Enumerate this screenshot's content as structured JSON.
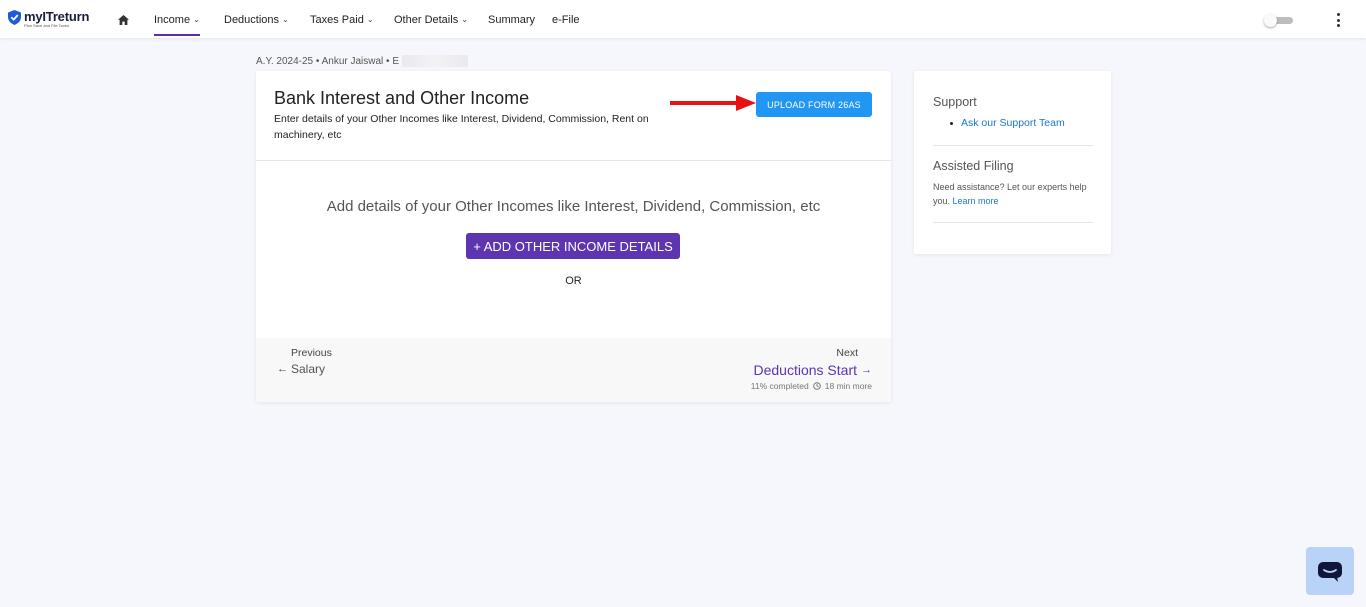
{
  "app": {
    "logo_name": "myITreturn",
    "logo_tagline": "Plan Save and File Taxes"
  },
  "nav": {
    "items": [
      {
        "label": "Income",
        "has_dropdown": true,
        "active": true
      },
      {
        "label": "Deductions",
        "has_dropdown": true
      },
      {
        "label": "Taxes Paid",
        "has_dropdown": true
      },
      {
        "label": "Other Details",
        "has_dropdown": true
      },
      {
        "label": "Summary",
        "has_dropdown": false
      },
      {
        "label": "e-File",
        "has_dropdown": false
      }
    ],
    "chevron": "⌄"
  },
  "breadcrumb": {
    "text": "A.Y. 2024-25 • Ankur Jaiswal • E"
  },
  "card": {
    "title": "Bank Interest and Other Income",
    "description": "Enter details of your Other Incomes like Interest, Dividend, Commission, Rent on machinery, etc",
    "upload_button": "UPLOAD FORM 26AS",
    "empty_text": "Add details of your Other Incomes like Interest, Dividend, Commission, etc",
    "add_button": "+ ADD OTHER INCOME DETAILS",
    "or_text": "OR"
  },
  "footer": {
    "prev_label": "Previous",
    "prev_target": "Salary",
    "next_label": "Next",
    "next_target": "Deductions Start",
    "progress_text": "11% completed",
    "time_text": "18 min more"
  },
  "side": {
    "support_heading": "Support",
    "support_link": "Ask our Support Team",
    "assisted_heading": "Assisted Filing",
    "assisted_text": "Need assistance? Let our experts help you.",
    "assisted_link": "Learn more"
  },
  "colors": {
    "brand_purple": "#5e35b1",
    "upload_blue": "#2196f3",
    "link_blue": "#1976d2",
    "annotation_arrow": "#e81010"
  },
  "icons": {
    "home": "home-icon",
    "toggle": "toggle-switch",
    "menu": "more-vert-icon",
    "chat": "chat-icon"
  }
}
